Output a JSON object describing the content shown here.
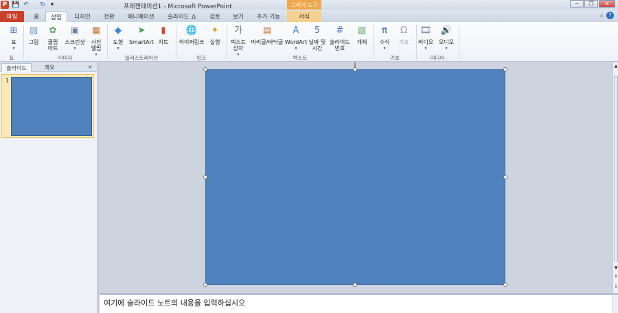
{
  "app": {
    "title": "프레젠테이션1 - Microsoft PowerPoint",
    "icon_letter": "P",
    "contextual_tab_group": "그리기 도구",
    "brand_color": "#d24726"
  },
  "qat": {
    "save_icon": "💾",
    "undo_icon": "↶",
    "redo_icon": "↻",
    "customize_icon": "▾"
  },
  "window": {
    "minimize": "─",
    "restore": "❐",
    "close": "✕",
    "help": "?",
    "minimize_ribbon": "▵"
  },
  "tabs": [
    "파일",
    "홈",
    "삽입",
    "디자인",
    "전환",
    "애니메이션",
    "슬라이드 쇼",
    "검토",
    "보기",
    "추가 기능",
    "서식"
  ],
  "active_tab": "삽입",
  "ribbon": {
    "buttons": [
      {
        "label": "표",
        "icon": "⊞",
        "icon_name": "table-icon",
        "color": "#4a78c2",
        "drop": true
      },
      {
        "label": "그림",
        "icon": "▨",
        "icon_name": "picture-icon",
        "color": "#6a9ad6"
      },
      {
        "label": "클립\n아트",
        "icon": "✿",
        "icon_name": "clip-art-icon",
        "color": "#5aa05a"
      },
      {
        "label": "스크린샷",
        "icon": "▣",
        "icon_name": "screenshot-icon",
        "color": "#6c7fa6",
        "drop": true
      },
      {
        "label": "사진\n앨범",
        "icon": "▦",
        "icon_name": "photo-album-icon",
        "color": "#c4762c",
        "drop": true
      },
      {
        "label": "도형",
        "icon": "◆",
        "icon_name": "shapes-icon",
        "color": "#3e86d1",
        "drop": true
      },
      {
        "label": "SmartArt",
        "icon": "➤",
        "icon_name": "smartart-icon",
        "color": "#3c9c4c"
      },
      {
        "label": "차트",
        "icon": "▮",
        "icon_name": "chart-icon",
        "color": "#c94a3a"
      },
      {
        "label": "하이퍼링크",
        "icon": "🌐",
        "icon_name": "hyperlink-icon",
        "color": "#2f7fc6"
      },
      {
        "label": "실행",
        "icon": "✦",
        "icon_name": "action-icon",
        "color": "#d4a22a"
      },
      {
        "label": "텍스트\n상자",
        "icon": "가",
        "icon_name": "text-box-icon",
        "color": "#666666",
        "drop": true
      },
      {
        "label": "머리글/바닥글",
        "icon": "▤",
        "icon_name": "header-footer-icon",
        "color": "#c4762c"
      },
      {
        "label": "WordArt",
        "icon": "A",
        "icon_name": "wordart-icon",
        "color": "#3e86d1",
        "drop": true
      },
      {
        "label": "날짜 및\n시간",
        "icon": "5",
        "icon_name": "date-time-icon",
        "color": "#4a78c2"
      },
      {
        "label": "슬라이드\n번호",
        "icon": "#",
        "icon_name": "slide-number-icon",
        "color": "#4a78c2"
      },
      {
        "label": "개체",
        "icon": "▧",
        "icon_name": "object-icon",
        "color": "#5aa05a"
      },
      {
        "label": "수식",
        "icon": "π",
        "icon_name": "equation-icon",
        "color": "#2b5fa6",
        "drop": true
      },
      {
        "label": "기호",
        "icon": "Ω",
        "icon_name": "symbol-icon",
        "color": "#9aa5b5",
        "disabled": true
      },
      {
        "label": "비디오",
        "icon": "🎞",
        "icon_name": "video-icon",
        "color": "#6c7fa6",
        "drop": true
      },
      {
        "label": "오디오",
        "icon": "🔊",
        "icon_name": "audio-icon",
        "color": "#d49a2a",
        "drop": true
      }
    ],
    "groups": [
      "표",
      "이미지",
      "일러스트레이션",
      "링크",
      "텍스트",
      "기호",
      "미디어"
    ]
  },
  "pane": {
    "tab_slides": "슬라이드",
    "tab_outline": "개요",
    "close": "×",
    "slide_number": "1"
  },
  "slide": {
    "fill": "#4f81bd"
  },
  "notes": {
    "placeholder": "여기에 슬라이드 노트의 내용을 입력하십시오"
  },
  "scroll": {
    "up": "▲",
    "down": "▼",
    "prev": "⇑",
    "next": "⇓"
  }
}
